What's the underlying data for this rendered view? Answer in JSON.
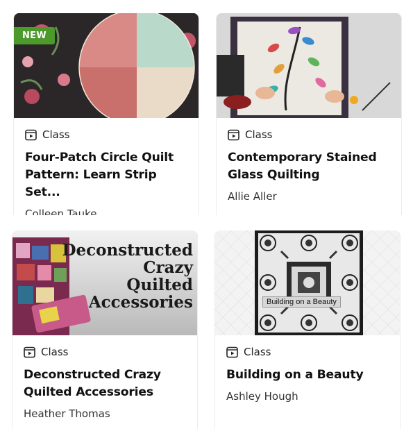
{
  "cards": [
    {
      "badge": "NEW",
      "type": "Class",
      "title_line1": "Four-Patch Circle Quilt",
      "title_line2": "Pattern: Learn Strip Set...",
      "author": "Colleen Tauke"
    },
    {
      "type": "Class",
      "title_line1": "Contemporary Stained",
      "title_line2": "Glass Quilting",
      "author": "Allie Aller"
    },
    {
      "type": "Class",
      "title_line1": "Deconstructed Crazy",
      "title_line2": "Quilted Accessories",
      "author": "Heather Thomas",
      "thumb_text": [
        "Deconstructed",
        "Crazy",
        "Quilted",
        "Accessories"
      ]
    },
    {
      "type": "Class",
      "title_line1": "Building on a Beauty",
      "title_line2": "",
      "author": "Ashley Hough",
      "thumb_caption": "Building on a Beauty"
    }
  ],
  "icons": {
    "type_icon": "video-class-icon"
  },
  "colors": {
    "badge_green": "#4c9a2a"
  }
}
